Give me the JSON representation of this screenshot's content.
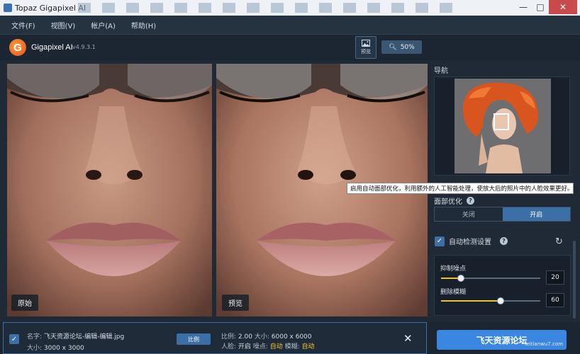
{
  "window": {
    "title": "Topaz Gigapixel AI",
    "minimize": "—",
    "maximize": "□",
    "close": "✕"
  },
  "menu": [
    "文件(F)",
    "视图(V)",
    "帐户(A)",
    "帮助(H)"
  ],
  "header": {
    "logo_letter": "G",
    "brand": "Gigapixel AI",
    "version": "v4.9.3.1",
    "preview_label": "预览",
    "zoom_label": "50%"
  },
  "panes": {
    "left_label": "原始",
    "right_label": "预览"
  },
  "navigator": {
    "title": "导航"
  },
  "tooltip": "启用自动面部优化，利用额外的人工智能处理，使放大后的照片中的人脸效果更好。",
  "face": {
    "title": "面部优化",
    "off_label": "关闭",
    "on_label": "开启",
    "selected": "开启"
  },
  "auto": {
    "label": "自动检测设置",
    "checked": true
  },
  "sliders": [
    {
      "label": "抑制噪点",
      "value": "20",
      "fraction": 0.2
    },
    {
      "label": "删除模糊",
      "value": "60",
      "fraction": 0.6
    }
  ],
  "file": {
    "name_label": "名字:",
    "name": "飞天资源论坛-编辑-编辑.jpg",
    "size_label": "大小:",
    "size": "3000 x 3000",
    "ratio_button": "比例",
    "scale_label": "比例:",
    "scale": "2.00",
    "out_size_label": "大小:",
    "out_size": "6000 x 6000",
    "face_label": "人脸:",
    "face": "开启",
    "noise_label": "噪点:",
    "noise": "自动",
    "blur_label": "模糊:",
    "blur": "自动"
  },
  "export_label": "飞天资源论坛",
  "watermark": "feitianwu7.com",
  "colors": {
    "accent": "#3b6fa6",
    "slider_fill": "#f2c12e",
    "export": "#3a86e0"
  }
}
